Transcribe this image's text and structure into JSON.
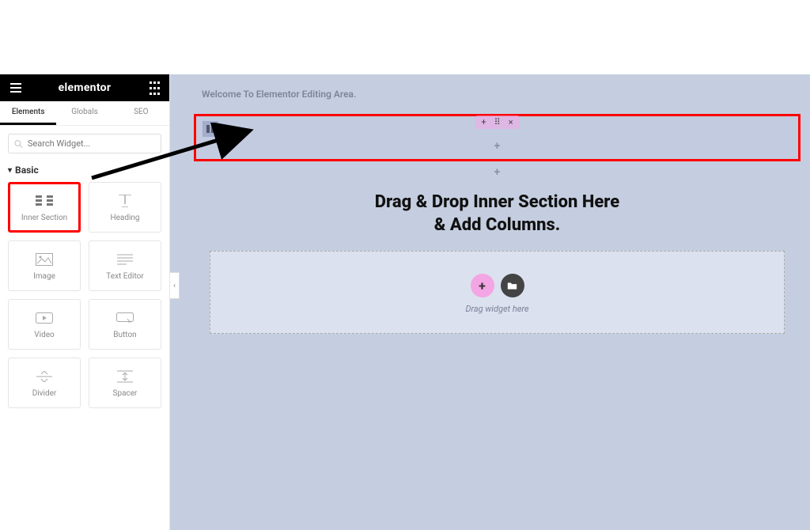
{
  "header": {
    "brand": "elementor"
  },
  "sidebar": {
    "tabs": [
      "Elements",
      "Globals",
      "SEO"
    ],
    "active_tab": 0,
    "search_placeholder": "Search Widget...",
    "category_label": "Basic",
    "widgets": [
      {
        "name": "inner-section",
        "label": "Inner Section",
        "highlight": true
      },
      {
        "name": "heading",
        "label": "Heading"
      },
      {
        "name": "image",
        "label": "Image"
      },
      {
        "name": "text-editor",
        "label": "Text Editor"
      },
      {
        "name": "video",
        "label": "Video"
      },
      {
        "name": "button",
        "label": "Button"
      },
      {
        "name": "divider",
        "label": "Divider"
      },
      {
        "name": "spacer",
        "label": "Spacer"
      }
    ]
  },
  "canvas": {
    "intro": "Welcome To Elementor Editing Area.",
    "section_controls": {
      "add": "+",
      "handle": "⠿",
      "close": "×"
    },
    "annotation_line1": "Drag & Drop Inner Section Here",
    "annotation_line2": "& Add Columns.",
    "dropzone": {
      "add_label": "+",
      "hint": "Drag widget here"
    }
  }
}
